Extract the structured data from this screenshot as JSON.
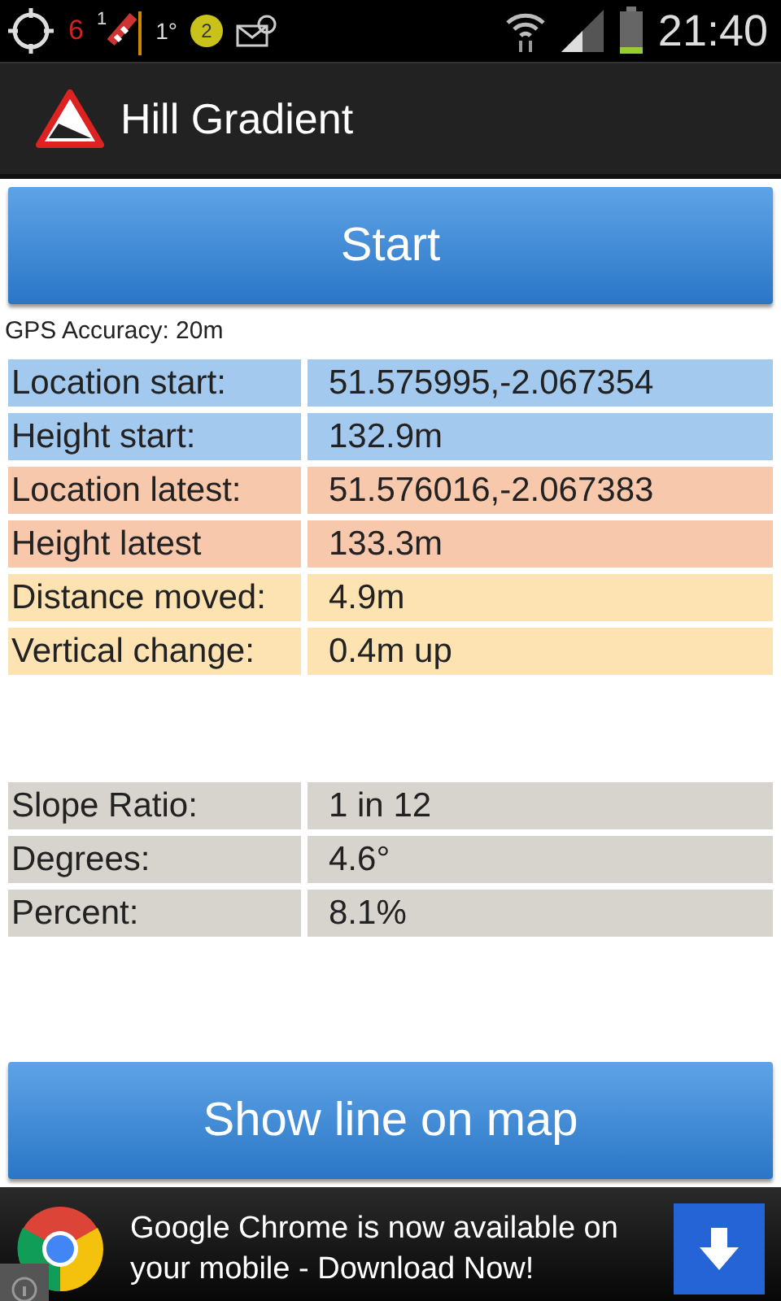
{
  "status_bar": {
    "gps_count": "6",
    "flag_count": "1",
    "temperature": "1°",
    "badge_count": "2",
    "time": "21:40"
  },
  "title_bar": {
    "title": "Hill Gradient"
  },
  "start_button": {
    "label": "Start"
  },
  "gps_accuracy": "GPS Accuracy: 20m",
  "measurements": [
    {
      "label": "Location start:",
      "value": "51.575995,-2.067354",
      "color": "#a3c9ef"
    },
    {
      "label": "Height start:",
      "value": "132.9m",
      "color": "#a3c9ef"
    },
    {
      "label": "Location latest:",
      "value": "51.576016,-2.067383",
      "color": "#f8c8ad"
    },
    {
      "label": "Height latest",
      "value": "133.3m",
      "color": "#f8c8ad"
    },
    {
      "label": "Distance moved:",
      "value": "4.9m",
      "color": "#fde2b2"
    },
    {
      "label": "Vertical change:",
      "value": "0.4m up",
      "color": "#fde2b2"
    }
  ],
  "results": [
    {
      "label": "Slope Ratio:",
      "value": "1 in 12",
      "color": "#d6d4cc"
    },
    {
      "label": "Degrees:",
      "value": "4.6°",
      "color": "#d6d4cc"
    },
    {
      "label": "Percent:",
      "value": "8.1%",
      "color": "#d6d4cc"
    }
  ],
  "map_button": {
    "label": "Show line on map"
  },
  "ad": {
    "text": "Google Chrome is now available on your mobile - Download Now!"
  }
}
